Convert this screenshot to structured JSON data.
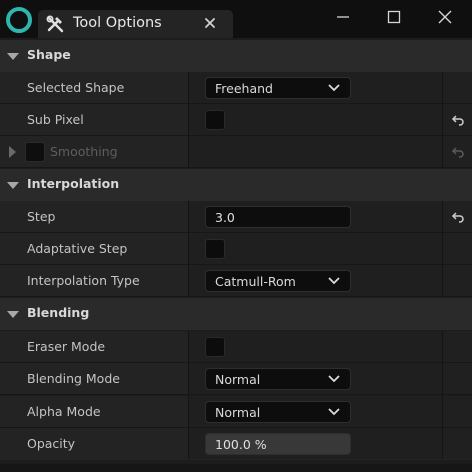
{
  "window": {
    "tab_title": "Tool Options",
    "tab_icon": "tools-icon",
    "controls": [
      "minimize-icon",
      "maximize-icon",
      "close-icon"
    ]
  },
  "sections": {
    "shape": {
      "label": "Shape",
      "selected_shape": {
        "label": "Selected Shape",
        "value": "Freehand"
      },
      "sub_pixel": {
        "label": "Sub Pixel",
        "checked": false
      },
      "smoothing": {
        "label": "Smoothing",
        "checked": false,
        "enabled": false
      }
    },
    "interpolation": {
      "label": "Interpolation",
      "step": {
        "label": "Step",
        "value": "3.0"
      },
      "adaptative_step": {
        "label": "Adaptative Step",
        "checked": false
      },
      "interpolation_type": {
        "label": "Interpolation Type",
        "value": "Catmull-Rom"
      }
    },
    "blending": {
      "label": "Blending",
      "eraser_mode": {
        "label": "Eraser Mode",
        "checked": false
      },
      "blending_mode": {
        "label": "Blending Mode",
        "value": "Normal"
      },
      "alpha_mode": {
        "label": "Alpha Mode",
        "value": "Normal"
      },
      "opacity": {
        "label": "Opacity",
        "value": "100.0 %"
      }
    }
  },
  "colors": {
    "accent_logo": "#2fb5ae",
    "panel_bg": "#1c1c1c",
    "section_bg": "#2a2a2a"
  }
}
